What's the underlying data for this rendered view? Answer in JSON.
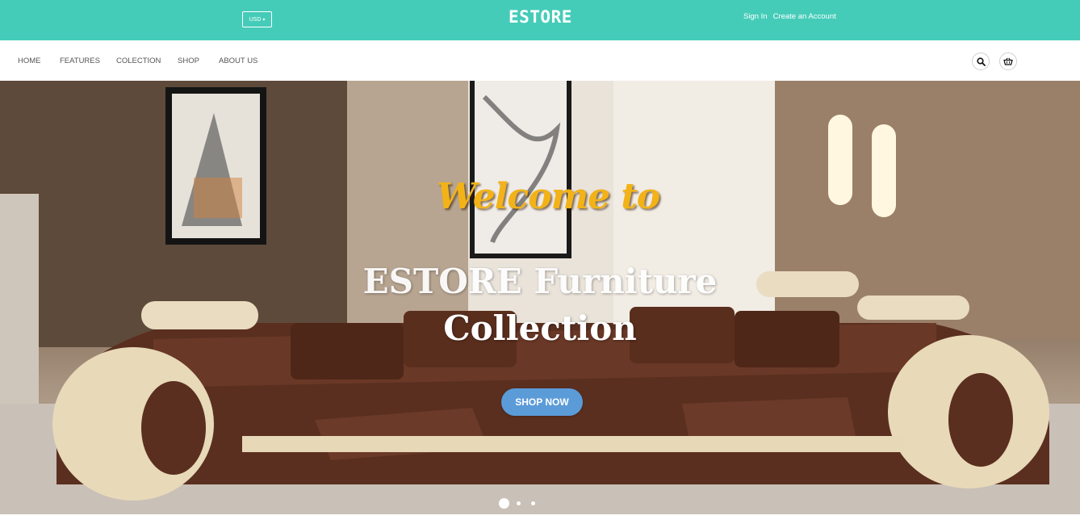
{
  "topbar": {
    "currency": "USD",
    "logo": "ESTORE",
    "sign_in": "Sign In",
    "create_account": "Create an Account"
  },
  "nav": {
    "items": [
      "HOME",
      "FEATURES",
      "COLECTION",
      "SHOP",
      "ABOUT US"
    ],
    "icons": [
      "search-icon",
      "basket-icon"
    ]
  },
  "hero": {
    "welcome": "Welcome to",
    "title_line1": "ESTORE Furniture",
    "title_line2": "Collection",
    "cta": "SHOP NOW",
    "slides": 3,
    "active_slide": 1
  },
  "colors": {
    "topbar": "#45ccb9",
    "welcome_text": "#f2b218",
    "cta_button": "#5b9bd8"
  }
}
